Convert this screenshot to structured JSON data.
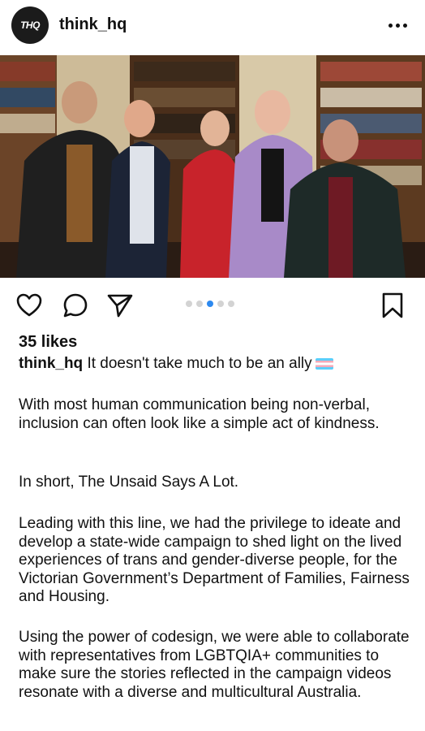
{
  "header": {
    "avatar_text": "THQ",
    "username": "think_hq",
    "more_icon": "more-horizontal-icon"
  },
  "post": {
    "image_alt": "Group of five people standing in a library with bookshelves",
    "carousel": {
      "count": 5,
      "active_index": 2,
      "active_color": "#2d89ef"
    },
    "likes": "35 likes",
    "caption_user": "think_hq",
    "caption_text": "It doesn't take much to be an ally",
    "paragraphs": [
      "With most human communication being non-verbal, inclusion can often look like a simple act of kindness.",
      "In short, The Unsaid Says A Lot.",
      "Leading with this line, we had the privilege to ideate and develop a state-wide campaign to shed light on the lived experiences of trans and gender-diverse people, for the Victorian Government’s Department of Families, Fairness and Housing.",
      "Using the power of codesign, we were able to collaborate with representatives from LGBTQIA+ communities to make sure the stories reflected in the campaign videos resonate with a diverse and multicultural Australia."
    ]
  },
  "icons": {
    "like": "heart-icon",
    "comment": "comment-icon",
    "share": "send-icon",
    "save": "bookmark-icon",
    "tag": "person-tag-icon",
    "flag": "transgender-flag-icon"
  }
}
